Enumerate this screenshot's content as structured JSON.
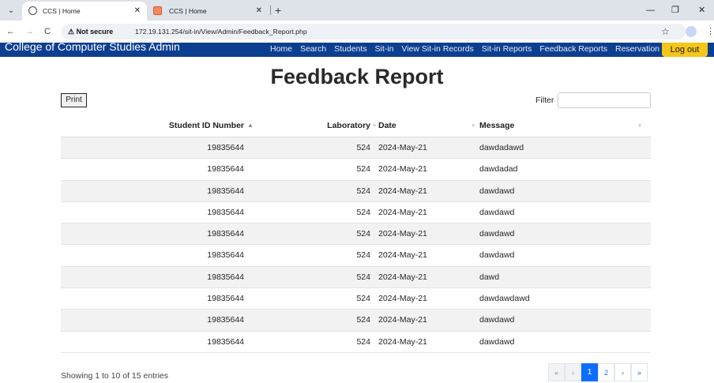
{
  "browser": {
    "tabs": [
      {
        "title": "CCS | Home",
        "active": true
      },
      {
        "title": "CCS | Home",
        "active": false
      }
    ],
    "new_tab": "+",
    "security_label": "Not secure",
    "url": "172.19.131.254/sit-in/View/Admin/Feedback_Report.php"
  },
  "navbar": {
    "brand": "College of Computer Studies Admin",
    "links": [
      "Home",
      "Search",
      "Students",
      "Sit-in",
      "View Sit-in Records",
      "Sit-in Reports",
      "Feedback Reports",
      "Reservation"
    ],
    "logout": "Log out",
    "brand_color": "#0d3f91",
    "logout_color": "#f5c518"
  },
  "page": {
    "title": "Feedback Report",
    "print_label": "Print",
    "filter_label": "Filter",
    "filter_value": ""
  },
  "table": {
    "columns": [
      "Student ID Number",
      "Laboratory",
      "Date",
      "Message"
    ],
    "rows": [
      [
        "19835644",
        "524",
        "2024-May-21",
        "dawdadawd"
      ],
      [
        "19835644",
        "524",
        "2024-May-21",
        "dawdadad"
      ],
      [
        "19835644",
        "524",
        "2024-May-21",
        "dawdawd"
      ],
      [
        "19835644",
        "524",
        "2024-May-21",
        "dawdawd"
      ],
      [
        "19835644",
        "524",
        "2024-May-21",
        "dawdawd"
      ],
      [
        "19835644",
        "524",
        "2024-May-21",
        "dawdawd"
      ],
      [
        "19835644",
        "524",
        "2024-May-21",
        "dawd"
      ],
      [
        "19835644",
        "524",
        "2024-May-21",
        "dawdawdawd"
      ],
      [
        "19835644",
        "524",
        "2024-May-21",
        "dawdawd"
      ],
      [
        "19835644",
        "524",
        "2024-May-21",
        "dawdawd"
      ]
    ]
  },
  "footer": {
    "info": "Showing 1 to 10 of 15 entries",
    "pagination": {
      "first": "«",
      "prev": "‹",
      "pages": [
        "1",
        "2"
      ],
      "current": "1",
      "next": "›",
      "last": "»"
    }
  }
}
